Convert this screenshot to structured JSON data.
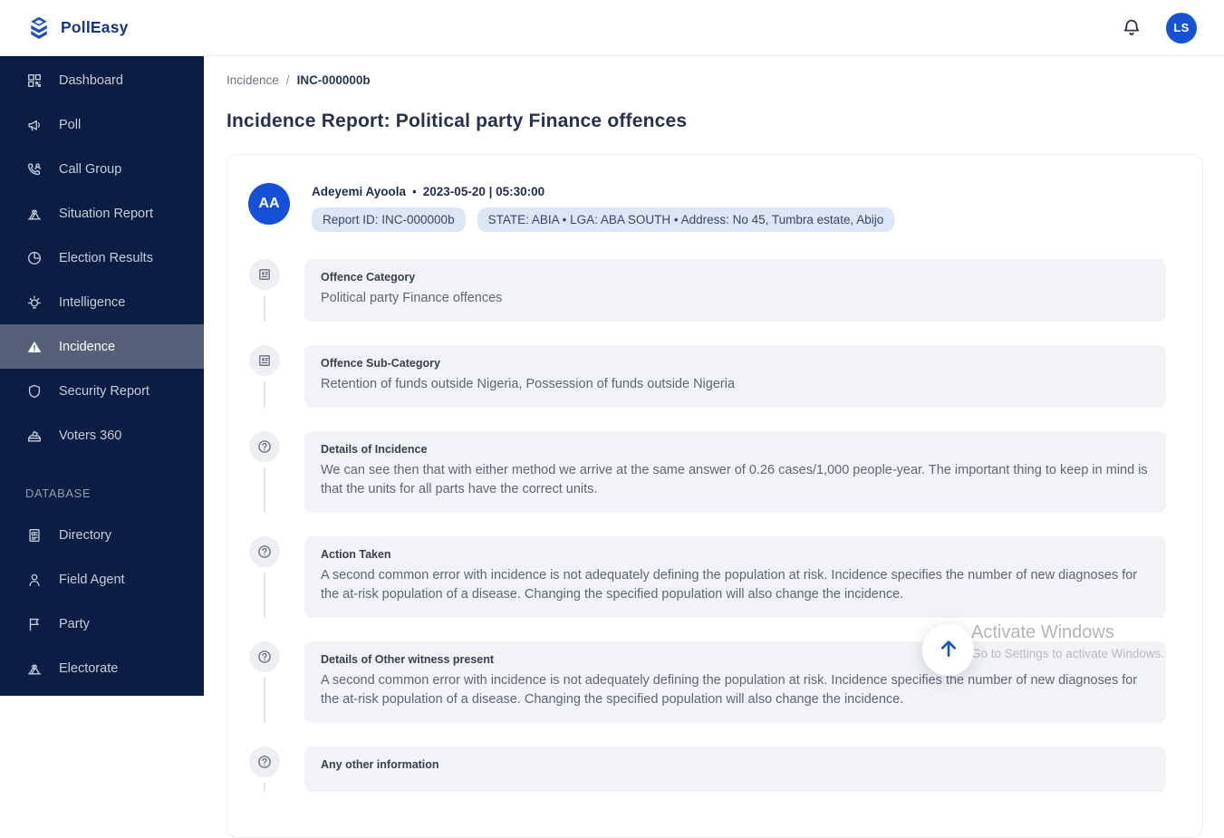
{
  "brand": {
    "name": "PollEasy"
  },
  "header": {
    "user_initials": "LS",
    "icons": [
      "bell-icon"
    ]
  },
  "sidebar": {
    "main_items": [
      {
        "label": "Dashboard",
        "icon": "dashboard-icon",
        "active": false
      },
      {
        "label": "Poll",
        "icon": "poll-icon",
        "active": false
      },
      {
        "label": "Call Group",
        "icon": "call-group-icon",
        "active": false
      },
      {
        "label": "Situation Report",
        "icon": "situation-report-icon",
        "active": false
      },
      {
        "label": "Election Results",
        "icon": "election-results-icon",
        "active": false
      },
      {
        "label": "Intelligence",
        "icon": "intelligence-icon",
        "active": false
      },
      {
        "label": "Incidence",
        "icon": "incidence-icon",
        "active": true
      },
      {
        "label": "Security Report",
        "icon": "security-report-icon",
        "active": false
      },
      {
        "label": "Voters 360",
        "icon": "voters-360-icon",
        "active": false
      }
    ],
    "section_label": "DATABASE",
    "database_items": [
      {
        "label": "Directory",
        "icon": "directory-icon",
        "active": false
      },
      {
        "label": "Field Agent",
        "icon": "field-agent-icon",
        "active": false
      },
      {
        "label": "Party",
        "icon": "party-icon",
        "active": false
      },
      {
        "label": "Electorate",
        "icon": "electorate-icon",
        "active": false
      }
    ]
  },
  "breadcrumb": {
    "parent": "Incidence",
    "separator": "/",
    "current": "INC-000000b"
  },
  "page": {
    "title": "Incidence Report: Political party Finance offences"
  },
  "report": {
    "reporter_initials": "AA",
    "reporter_name": "Adeyemi Ayoola",
    "meta_separator": "•",
    "datetime": "2023-05-20 | 05:30:00",
    "badges": [
      "Report ID: INC-000000b",
      "STATE: ABIA • LGA: ABA SOUTH • Address: No 45, Tumbra estate, Abijo"
    ],
    "entries": [
      {
        "icon": "form-icon",
        "title": "Offence Category",
        "body": "Political party Finance offences"
      },
      {
        "icon": "form-icon",
        "title": "Offence Sub-Category",
        "body": "Retention of funds outside Nigeria, Possession of funds outside Nigeria"
      },
      {
        "icon": "question-icon",
        "title": "Details of Incidence",
        "body": "We can see then that with either method we arrive at the same answer of 0.26 cases/1,000 people-year. The important thing to keep in mind is that the units for all parts have the correct units."
      },
      {
        "icon": "question-icon",
        "title": "Action Taken",
        "body": "A second common error with incidence is not adequately defining the population at risk. Incidence specifies the number of new diagnoses for the at-risk population of a disease. Changing the specified population will also change the incidence."
      },
      {
        "icon": "question-icon",
        "title": "Details of Other witness present",
        "body": "A second common error with incidence is not adequately defining the population at risk. Incidence specifies the number of new diagnoses for the at-risk population of a disease. Changing the specified population will also change the incidence."
      },
      {
        "icon": "question-icon",
        "title": "Any other information",
        "body": ""
      }
    ]
  },
  "watermark": {
    "line1": "Activate Windows",
    "line2": "Go to Settings to activate Windows."
  },
  "colors": {
    "accent_blue": "#1552d6",
    "sidebar_bg": "#0a1e44",
    "sidebar_active_bg": "#556179",
    "badge_bg": "#dde6f6",
    "entry_card_bg": "#f1f3f6",
    "logo_blue": "#1d4fc4"
  }
}
